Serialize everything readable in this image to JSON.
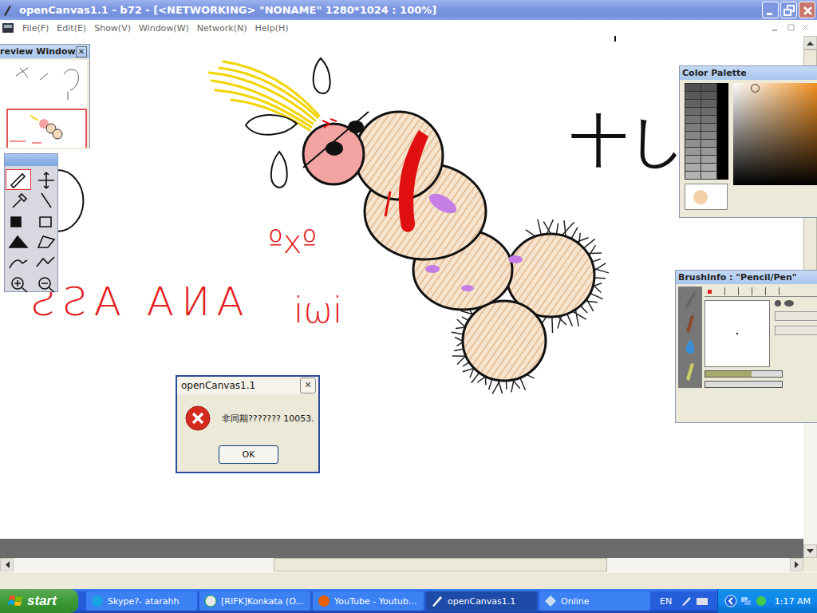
{
  "window": {
    "title": "openCanvas1.1 - b72 - [<NETWORKING>  \"NONAME\" 1280*1024 : 100%]"
  },
  "menu": [
    "File(F)",
    "Edit(E)",
    "Show(V)",
    "Window(W)",
    "Network(N)",
    "Help(H)"
  ],
  "canvas_texts": [
    {
      "text": "ANA ASS",
      "kind": "mirrored",
      "color": "#e31b1b"
    },
    {
      "text": "ºxº",
      "kind": "face",
      "color": "#e31b1b"
    },
    {
      "text": "iωi",
      "kind": "face2",
      "color": "#e31b1b"
    },
    {
      "text": "十し",
      "kind": "kana",
      "color": "#111111"
    }
  ],
  "preview_window": {
    "title": "review Window",
    "close": "✕"
  },
  "tools": [
    {
      "selected": true
    },
    {
      "selected": false
    },
    {
      "selected": false
    },
    {
      "selected": false
    },
    {
      "selected": false
    },
    {
      "selected": false
    },
    {
      "selected": false
    },
    {
      "selected": false
    },
    {
      "selected": false
    },
    {
      "selected": false
    },
    {
      "selected": false
    },
    {
      "selected": false
    }
  ],
  "color_palette": {
    "title": "Color Palette"
  },
  "brush_info": {
    "title": "BrushInfo : \"Pencil/Pen\""
  },
  "horizontal_scroll": {
    "offset": 0.335,
    "level": 0.43
  },
  "vertical_scroll": {
    "offset": 0.0,
    "level": 0.74
  },
  "dialog": {
    "title": "openCanvas1.1",
    "close": "✕",
    "message": "非同期??????? 10053.",
    "button": "OK"
  },
  "taskbar": {
    "start": "start",
    "items": [
      {
        "label": "Skype?- atarahh",
        "selected": false
      },
      {
        "label": "[RIFK]Konkata (O...",
        "selected": false
      },
      {
        "label": "YouTube - Youtub...",
        "selected": false
      },
      {
        "label": "openCanvas1.1",
        "selected": true
      },
      {
        "label": "Online",
        "selected": false
      }
    ],
    "language": "EN",
    "clock": "1:17 AM"
  }
}
